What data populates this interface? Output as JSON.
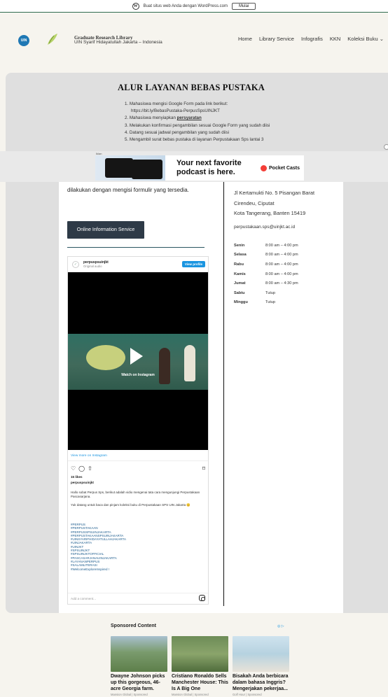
{
  "wp_banner": {
    "text": "Buat situs web Anda dengan WordPress.com",
    "button": "Mulai"
  },
  "header": {
    "title": "Graduate Research Library",
    "subtitle": "UIN Syarif Hidayatullah Jakarta – Indonesia",
    "logo_text": "UIN",
    "nav": [
      "Home",
      "Library Service",
      "Infografis",
      "KKN",
      "Koleksi Buku ⌄"
    ]
  },
  "panel": {
    "title": "ALUR LAYANAN BEBAS PUSTAKA",
    "steps": [
      "1. Mahasiswa mengisi Google Form pada link berikut:",
      "https://bit.ly/BebasPustaka-PerpusSpsUINJKT",
      "2. Mahasiswa menyiapkan ",
      "persyaratan",
      "3. Melakukan konfirmasi pengambilan sesuai Google Form yang sudah diisi",
      "4. Datang sesuai jadwal pengambilan yang sudah diisi",
      "5. Mengambil surat bebas pustaka di layanan Perpustakaan Sps lantai 3"
    ]
  },
  "ad": {
    "label": "Iklan",
    "headline_1": "Your next favorite",
    "headline_2": "podcast is here.",
    "brand": "Pocket Casts"
  },
  "content": {
    "lead": "dilakukan dengan mengisi formulir  yang tersedia.",
    "button": "Online Information Service"
  },
  "instagram": {
    "username": "perpuspsuinjkt",
    "sub": "Original audio",
    "view_profile": "View profile",
    "watch": "Watch on Instagram",
    "view_more": "View more on Instagram",
    "likes": "15 likes",
    "caption_user": "perpuspsuinjkt",
    "caption_1": "Hallo sobat Perpus Sps, berikut adalah vidio mengenai tata cara mengunjungi Perpustakaan Pascasarjana.",
    "caption_2": "Yuk datang untuk baca dan pinjam koleksi buku di Perpustakaan SPS UIN Jakarta 😊",
    "tags": [
      "#PERPUS",
      "#PERPUSTAKAAN",
      "#PERPUSSPSUINJAKARTA",
      "#PERPUSTAKAANSPSUINJAKARTA",
      "#UINSYARIFHIDAYATULLAHJAKARTA",
      "#UINJAKARTA",
      "#UINJKT",
      "#SPSUINJKT",
      "#SPSUINJKTOFFICIAL",
      "#PASCASARJANAUINJAKARTA",
      "#LAYANANPERPUS",
      "#SALAMLITERASI",
      "#WelcomeExploreInspired !"
    ],
    "comment_placeholder": "Add a comment..."
  },
  "contact": {
    "address": [
      "Jl Kertamukti No. 5 Pisangan Barat",
      "Cirendeu, Ciputat",
      "Kota Tangerang, Banten 15419"
    ],
    "email": "perpustakaan.sps@uinjkt.ac.id",
    "hours": [
      {
        "day": "Senin",
        "time": "8:00 am – 4:00 pm"
      },
      {
        "day": "Selasa",
        "time": "8:00 am – 4:00 pm"
      },
      {
        "day": "Rabu",
        "time": "8:00 am – 4:00 pm"
      },
      {
        "day": "Kamis",
        "time": "8:00 am – 4:00 pm"
      },
      {
        "day": "Jumat",
        "time": "8:00 am – 4:30 pm"
      },
      {
        "day": "Sabtu",
        "time": "Tutup"
      },
      {
        "day": "Minggu",
        "time": "Tutup"
      }
    ]
  },
  "sponsored": {
    "heading": "Sponsored Content",
    "adchoice": "◎ ▷",
    "cards": [
      {
        "title": "Dwayne Johnson picks up this gorgeous, 46-acre Georgia farm.",
        "source": "Mansion Global | Sponsored"
      },
      {
        "title": "Cristiano Ronaldo Sells Manchester House: This Is A Big One",
        "source": "Mansion Global | Sponsored"
      },
      {
        "title": "Bisakah Anda berbicara dalam bahasa Inggris? Mengerjakan pekerjaa...",
        "source": "Golf Hour | Sponsored"
      }
    ]
  }
}
